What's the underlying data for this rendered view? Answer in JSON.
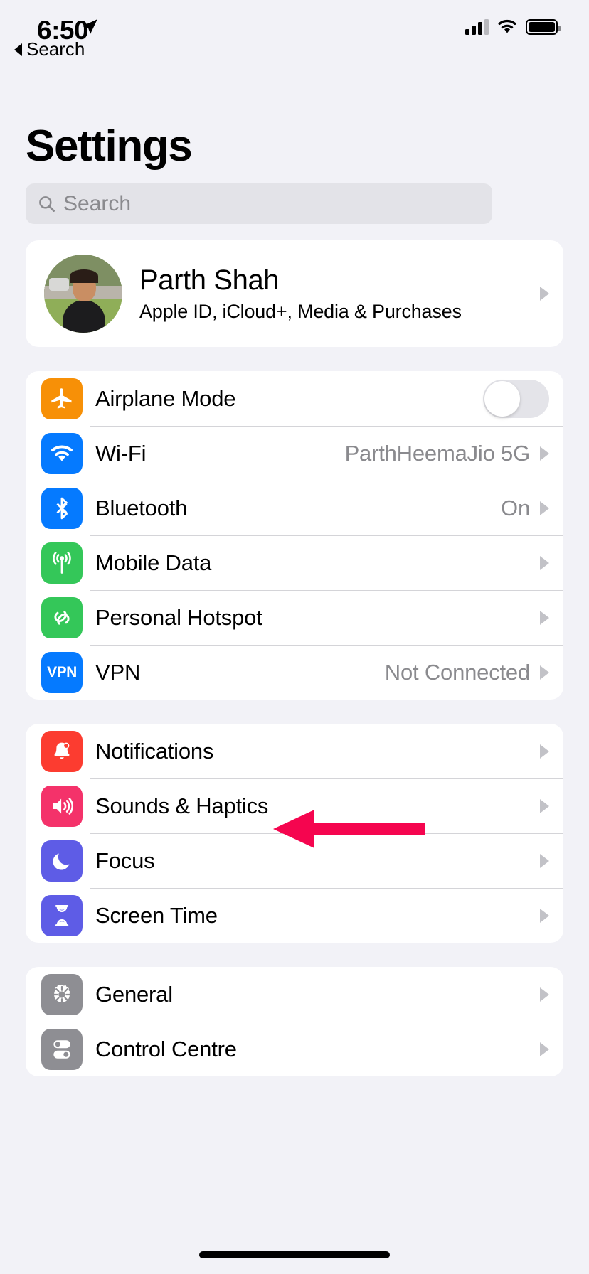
{
  "status_bar": {
    "time": "6:50",
    "back_label": "Search",
    "location_icon": "location-arrow-icon",
    "signal_icon": "cellular-bars-icon",
    "wifi_icon": "wifi-icon",
    "battery_icon": "battery-icon"
  },
  "header": {
    "title": "Settings"
  },
  "search": {
    "placeholder": "Search",
    "value": "",
    "icon": "search-icon"
  },
  "account": {
    "name": "Parth Shah",
    "subtitle": "Apple ID, iCloud+, Media & Purchases",
    "avatar_icon": "profile-photo-avatar",
    "chevron": "chevron-right-icon"
  },
  "groups": [
    {
      "id": "connectivity",
      "rows": [
        {
          "label": "Airplane Mode",
          "icon": "airplane-icon",
          "icon_color": "#f79007",
          "control": "toggle",
          "toggle_on": false
        },
        {
          "label": "Wi-Fi",
          "icon": "wifi-icon",
          "icon_color": "#057aff",
          "value": "ParthHeemaJio 5G",
          "control": "chevron"
        },
        {
          "label": "Bluetooth",
          "icon": "bluetooth-icon",
          "icon_color": "#057aff",
          "value": "On",
          "control": "chevron"
        },
        {
          "label": "Mobile Data",
          "icon": "antenna-icon",
          "icon_color": "#34c759",
          "value": "",
          "control": "chevron"
        },
        {
          "label": "Personal Hotspot",
          "icon": "hotspot-link-icon",
          "icon_color": "#34c759",
          "value": "",
          "control": "chevron"
        },
        {
          "label": "VPN",
          "icon": "vpn-badge-icon",
          "icon_color": "#057aff",
          "value": "Not Connected",
          "control": "chevron"
        }
      ]
    },
    {
      "id": "alerts",
      "rows": [
        {
          "label": "Notifications",
          "icon": "bell-icon",
          "icon_color": "#fc3c30",
          "value": "",
          "control": "chevron"
        },
        {
          "label": "Sounds & Haptics",
          "icon": "speaker-waves-icon",
          "icon_color": "#f4326a",
          "value": "",
          "control": "chevron",
          "annotated": true
        },
        {
          "label": "Focus",
          "icon": "moon-icon",
          "icon_color": "#5e5ce6",
          "value": "",
          "control": "chevron"
        },
        {
          "label": "Screen Time",
          "icon": "hourglass-icon",
          "icon_color": "#5e5ce6",
          "value": "",
          "control": "chevron"
        }
      ]
    },
    {
      "id": "system",
      "rows": [
        {
          "label": "General",
          "icon": "gear-icon",
          "icon_color": "#8e8e93",
          "value": "",
          "control": "chevron"
        },
        {
          "label": "Control Centre",
          "icon": "sliders-icon",
          "icon_color": "#8e8e93",
          "value": "",
          "control": "chevron"
        }
      ]
    }
  ],
  "annotation": {
    "type": "arrow-left",
    "color": "#f5054f",
    "points_at": "Sounds & Haptics"
  }
}
